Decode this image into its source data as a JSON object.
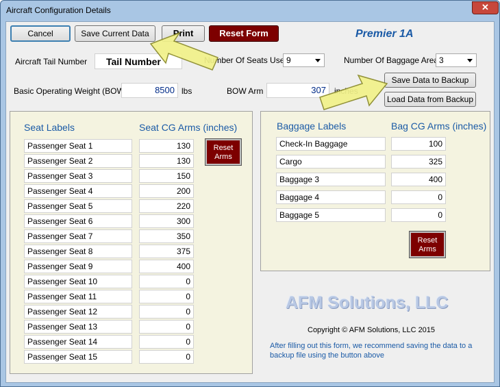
{
  "window": {
    "title": "Aircraft Configuration Details",
    "close_glyph": "✕"
  },
  "toolbar": {
    "cancel": "Cancel",
    "save_current": "Save Current Data",
    "print": "Print",
    "reset_form": "Reset Form",
    "model": "Premier 1A"
  },
  "aircraft": {
    "tail_label": "Aircraft Tail Number",
    "tail_value": "Tail Number",
    "seats_label": "Number Of Seats Used",
    "seats_value": "9",
    "baggage_label": "Number Of Baggage Areas",
    "baggage_value": "3",
    "bow_label": "Basic Operating Weight (BOW)",
    "bow_value": "8500",
    "bow_unit": "lbs",
    "arm_label": "BOW Arm",
    "arm_value": "307",
    "arm_unit": "inches"
  },
  "backup": {
    "save": "Save Data to Backup",
    "load": "Load Data from Backup"
  },
  "seats": {
    "labels_header": "Seat Labels",
    "arms_header": "Seat CG Arms (inches)",
    "reset_line1": "Reset",
    "reset_line2": "Arms",
    "rows": [
      {
        "label": "Passenger Seat 1",
        "arm": "130"
      },
      {
        "label": "Passenger Seat 2",
        "arm": "130"
      },
      {
        "label": "Passenger Seat 3",
        "arm": "150"
      },
      {
        "label": "Passenger Seat 4",
        "arm": "200"
      },
      {
        "label": "Passenger Seat 5",
        "arm": "220"
      },
      {
        "label": "Passenger Seat 6",
        "arm": "300"
      },
      {
        "label": "Passenger Seat 7",
        "arm": "350"
      },
      {
        "label": "Passenger Seat 8",
        "arm": "375"
      },
      {
        "label": "Passenger Seat 9",
        "arm": "400"
      },
      {
        "label": "Passenger Seat 10",
        "arm": "0"
      },
      {
        "label": "Passenger Seat 11",
        "arm": "0"
      },
      {
        "label": "Passenger Seat 12",
        "arm": "0"
      },
      {
        "label": "Passenger Seat 13",
        "arm": "0"
      },
      {
        "label": "Passenger Seat 14",
        "arm": "0"
      },
      {
        "label": "Passenger Seat 15",
        "arm": "0"
      }
    ]
  },
  "baggage": {
    "labels_header": "Baggage Labels",
    "arms_header": "Bag CG Arms (inches)",
    "reset_line1": "Reset",
    "reset_line2": "Arms",
    "rows": [
      {
        "label": "Check-In Baggage",
        "arm": "100"
      },
      {
        "label": "Cargo",
        "arm": "325"
      },
      {
        "label": "Baggage 3",
        "arm": "400"
      },
      {
        "label": "Baggage 4",
        "arm": "0"
      },
      {
        "label": "Baggage 5",
        "arm": "0"
      }
    ]
  },
  "footer": {
    "brand": "AFM Solutions, LLC",
    "copyright": "Copyright © AFM Solutions, LLC 2015",
    "note": "After filling out this form, we recommend saving the data to a backup file using the button above"
  },
  "colors": {
    "accent": "#1a5aa6",
    "reset": "#7d0000",
    "panel": "#f4f3e0",
    "arrow": "#f2f28a"
  }
}
